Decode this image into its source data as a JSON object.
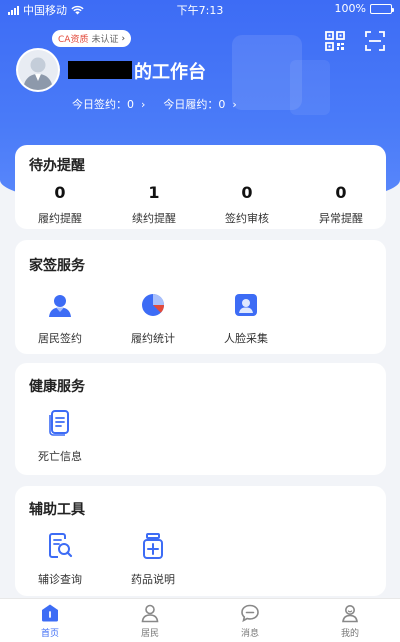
{
  "status_bar": {
    "carrier": "中国移动",
    "time": "下午7:13",
    "battery_text": "100%"
  },
  "header": {
    "ca_badge": {
      "label": "CA资质",
      "status": "未认证",
      "arrow": "›"
    },
    "title": "的工作台",
    "stats": {
      "sign_label": "今日签约：",
      "sign_value": "0",
      "perform_label": "今日履约：",
      "perform_value": "0",
      "arrow": "›"
    }
  },
  "todo": {
    "title": "待办提醒",
    "items": [
      {
        "count": "0",
        "label": "履约提醒"
      },
      {
        "count": "1",
        "label": "续约提醒"
      },
      {
        "count": "0",
        "label": "签约审核"
      },
      {
        "count": "0",
        "label": "异常提醒"
      }
    ]
  },
  "family_sign": {
    "title": "家签服务",
    "items": [
      {
        "label": "居民签约",
        "icon": "resident-user-icon"
      },
      {
        "label": "履约统计",
        "icon": "pie-chart-icon"
      },
      {
        "label": "人脸采集",
        "icon": "face-id-icon"
      }
    ]
  },
  "health": {
    "title": "健康服务",
    "items": [
      {
        "label": "死亡信息",
        "icon": "document-icon"
      }
    ]
  },
  "tools": {
    "title": "辅助工具",
    "items": [
      {
        "label": "辅诊查询",
        "icon": "search-document-icon"
      },
      {
        "label": "药品说明",
        "icon": "medicine-bottle-icon"
      }
    ]
  },
  "tabbar": {
    "items": [
      {
        "label": "首页",
        "active": true
      },
      {
        "label": "居民",
        "active": false
      },
      {
        "label": "消息",
        "active": false
      },
      {
        "label": "我的",
        "active": false
      }
    ]
  },
  "colors": {
    "primary": "#3d6cf5",
    "accent_red": "#e24a3b"
  }
}
